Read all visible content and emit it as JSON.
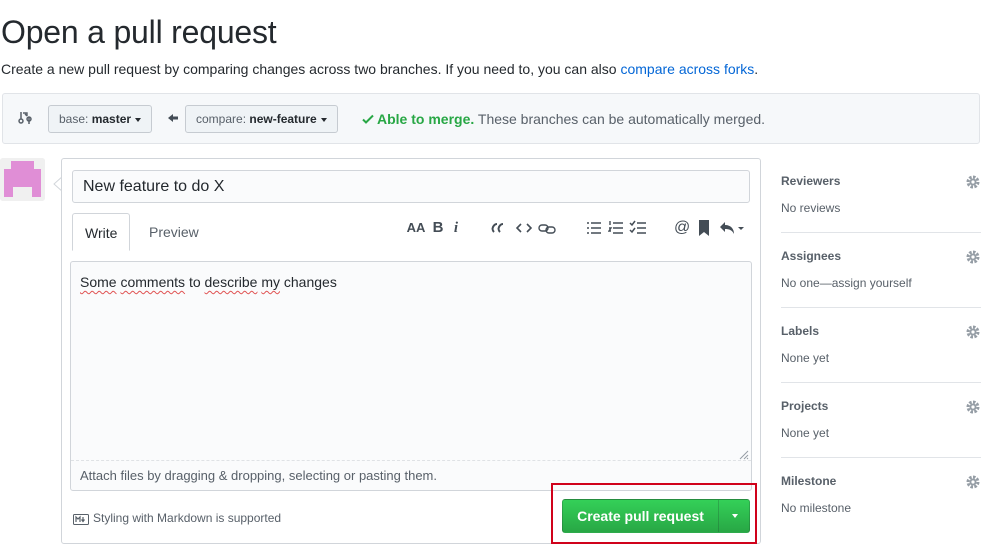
{
  "page": {
    "title": "Open a pull request",
    "subtitle_prefix": "Create a new pull request by comparing changes across two branches. If you need to, you can also ",
    "subtitle_link": "compare across forks",
    "subtitle_suffix": "."
  },
  "compare_bar": {
    "base_label": "base: ",
    "base_value": "master",
    "compare_label": "compare: ",
    "compare_value": "new-feature",
    "merge_ok": "Able to merge.",
    "merge_text": " These branches can be automatically merged."
  },
  "composer": {
    "title_value": "New feature to do X",
    "tabs": [
      {
        "label": "Write"
      },
      {
        "label": "Preview"
      }
    ],
    "toolbar": {
      "heading": "AA",
      "bold": "B",
      "italic": "i"
    },
    "body_words": [
      "Some",
      "comments",
      "to",
      "describe",
      "my",
      "changes"
    ],
    "attach_text": "Attach files by dragging & dropping, selecting or pasting them.",
    "markdown_note": "Styling with Markdown is supported",
    "create_button": "Create pull request"
  },
  "sidebar": {
    "sections": [
      {
        "heading": "Reviewers",
        "value": "No reviews"
      },
      {
        "heading": "Assignees",
        "value": "No one—assign yourself"
      },
      {
        "heading": "Labels",
        "value": "None yet"
      },
      {
        "heading": "Projects",
        "value": "None yet"
      },
      {
        "heading": "Milestone",
        "value": "No milestone"
      }
    ]
  },
  "colors": {
    "link": "#0366d6",
    "success": "#28a745",
    "button_green": "#2ea44f",
    "highlight_red": "#d0021b",
    "avatar": "#e08ed6"
  }
}
